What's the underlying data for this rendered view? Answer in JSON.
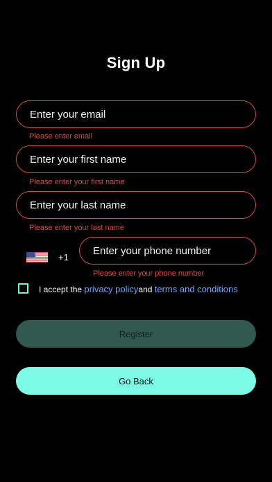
{
  "title": "Sign Up",
  "fields": {
    "email": {
      "placeholder": "Enter your email",
      "error": "Please enter email"
    },
    "first_name": {
      "placeholder": "Enter your first name",
      "error": "Please enter your first name"
    },
    "last_name": {
      "placeholder": "Enter your last name",
      "error": "Please enter your last name"
    },
    "phone": {
      "country_flag": "us-flag-icon",
      "country_code": "+1",
      "placeholder": "Enter your phone number",
      "error": "Please enter your phone number"
    }
  },
  "terms": {
    "prefix": "I accept the ",
    "privacy_link": "privacy policy",
    "middle": "and ",
    "terms_link": "terms and conditions"
  },
  "buttons": {
    "register": "Register",
    "go_back": "Go Back"
  },
  "colors": {
    "background": "#000000",
    "error": "#d84c4c",
    "accent": "#7cfce6",
    "link": "#6ea7ff",
    "register_bg": "#325950"
  }
}
